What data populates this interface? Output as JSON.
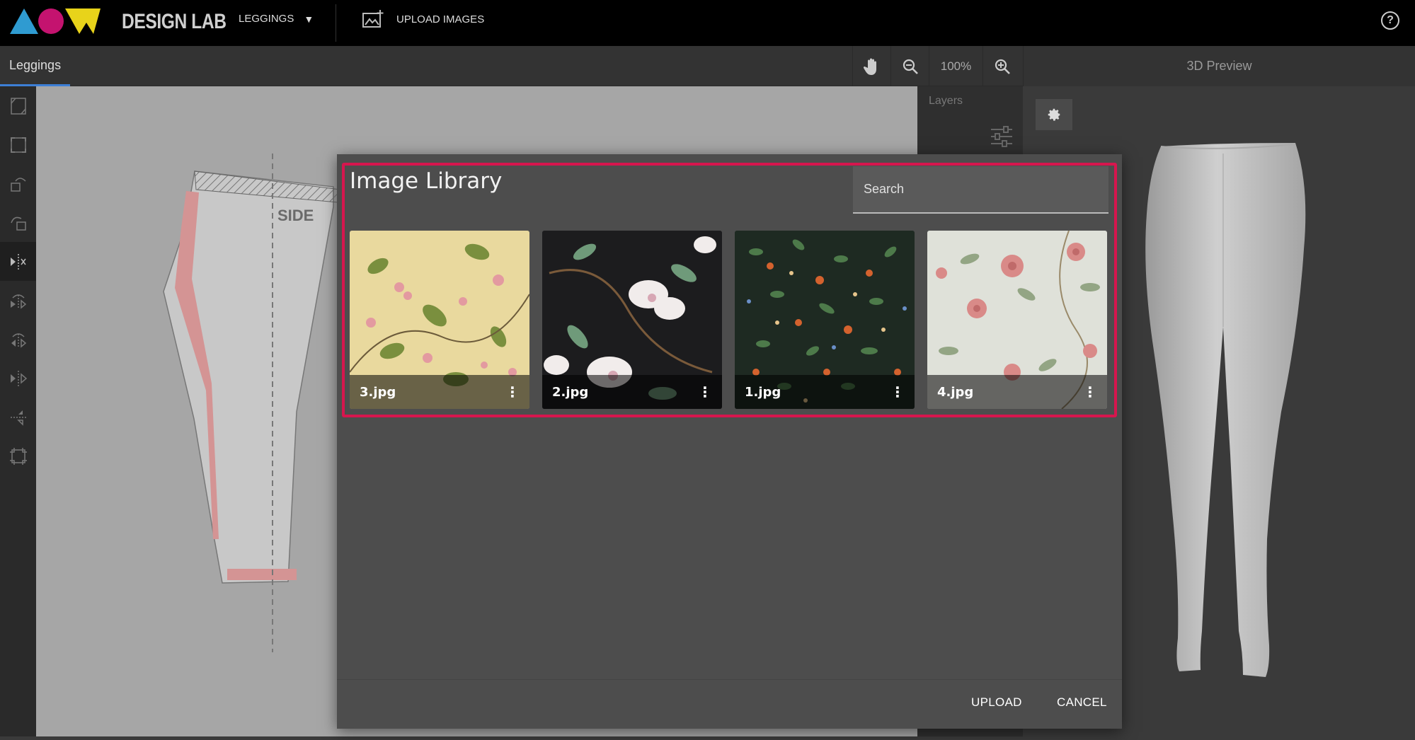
{
  "app": {
    "brand": "DESIGN LAB"
  },
  "topbar": {
    "product_label": "LEGGINGS",
    "upload_label": "UPLOAD IMAGES",
    "help_label": "?"
  },
  "toolbar": {
    "tab_label": "Leggings",
    "zoom_level": "100%"
  },
  "preview": {
    "title": "3D Preview"
  },
  "layers": {
    "title": "Layers"
  },
  "canvas": {
    "side_label": "SIDE"
  },
  "modal": {
    "title": "Image Library",
    "search_placeholder": "Search",
    "images": [
      {
        "name": "3.jpg"
      },
      {
        "name": "2.jpg"
      },
      {
        "name": "1.jpg"
      },
      {
        "name": "4.jpg"
      }
    ],
    "upload_label": "UPLOAD",
    "cancel_label": "CANCEL"
  },
  "colors": {
    "accent_highlight": "#d6164e",
    "tab_underline": "#3d7fd6",
    "logo_blue": "#2f9bd1",
    "logo_magenta": "#c4136f",
    "logo_yellow": "#e8d31a"
  }
}
